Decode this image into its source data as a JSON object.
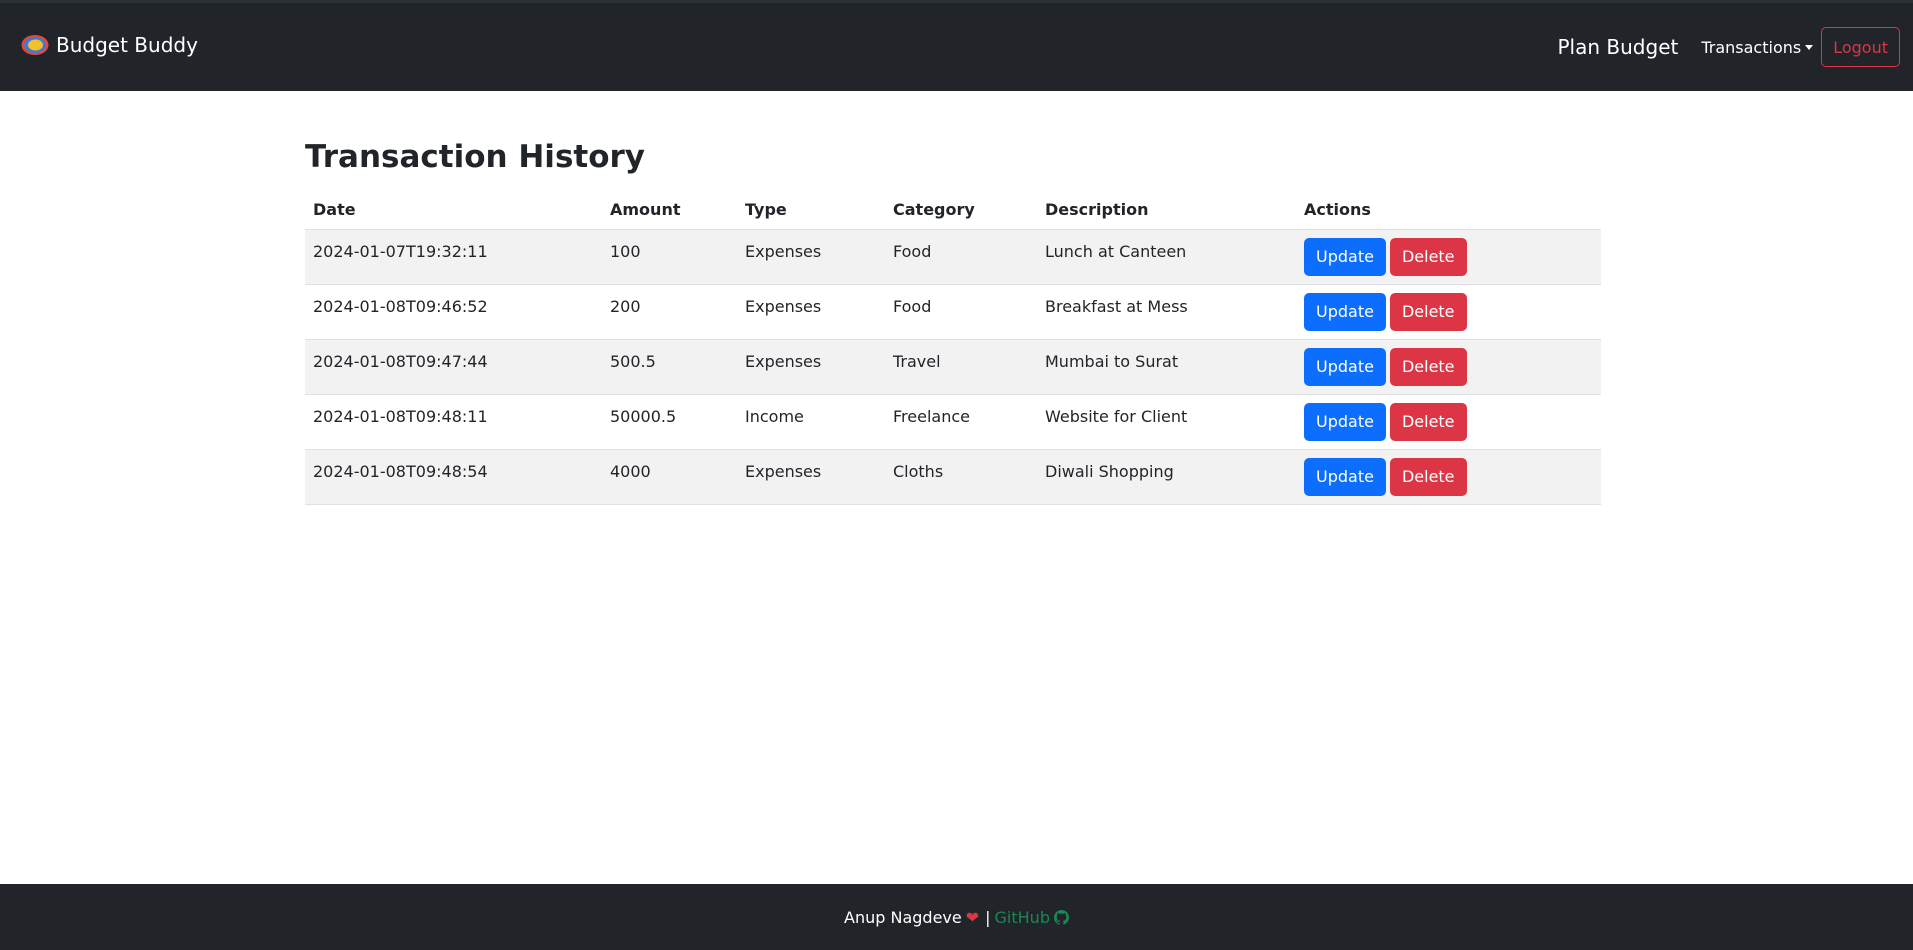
{
  "navbar": {
    "brand": "Budget Buddy",
    "plan_budget": "Plan Budget",
    "transactions": "Transactions",
    "logout": "Logout"
  },
  "page": {
    "title": "Transaction History"
  },
  "table": {
    "headers": [
      "Date",
      "Amount",
      "Type",
      "Category",
      "Description",
      "Actions"
    ],
    "rows": [
      {
        "date": "2024-01-07T19:32:11",
        "amount": "100",
        "type": "Expenses",
        "category": "Food",
        "description": "Lunch at Canteen"
      },
      {
        "date": "2024-01-08T09:46:52",
        "amount": "200",
        "type": "Expenses",
        "category": "Food",
        "description": "Breakfast at Mess"
      },
      {
        "date": "2024-01-08T09:47:44",
        "amount": "500.5",
        "type": "Expenses",
        "category": "Travel",
        "description": "Mumbai to Surat"
      },
      {
        "date": "2024-01-08T09:48:11",
        "amount": "50000.5",
        "type": "Income",
        "category": "Freelance",
        "description": "Website for Client"
      },
      {
        "date": "2024-01-08T09:48:54",
        "amount": "4000",
        "type": "Expenses",
        "category": "Cloths",
        "description": "Diwali Shopping"
      }
    ],
    "update_label": "Update",
    "delete_label": "Delete"
  },
  "footer": {
    "author": "Anup Nagdeve",
    "separator": "|",
    "github": "GitHub"
  },
  "icons": {
    "brand": "budget-logo-icon",
    "heart": "heart-icon",
    "github": "github-icon",
    "dropdown": "caret-down-icon"
  },
  "colors": {
    "navbar_bg": "#212529",
    "primary": "#0d6efd",
    "danger": "#dc3545",
    "success": "#198754"
  }
}
